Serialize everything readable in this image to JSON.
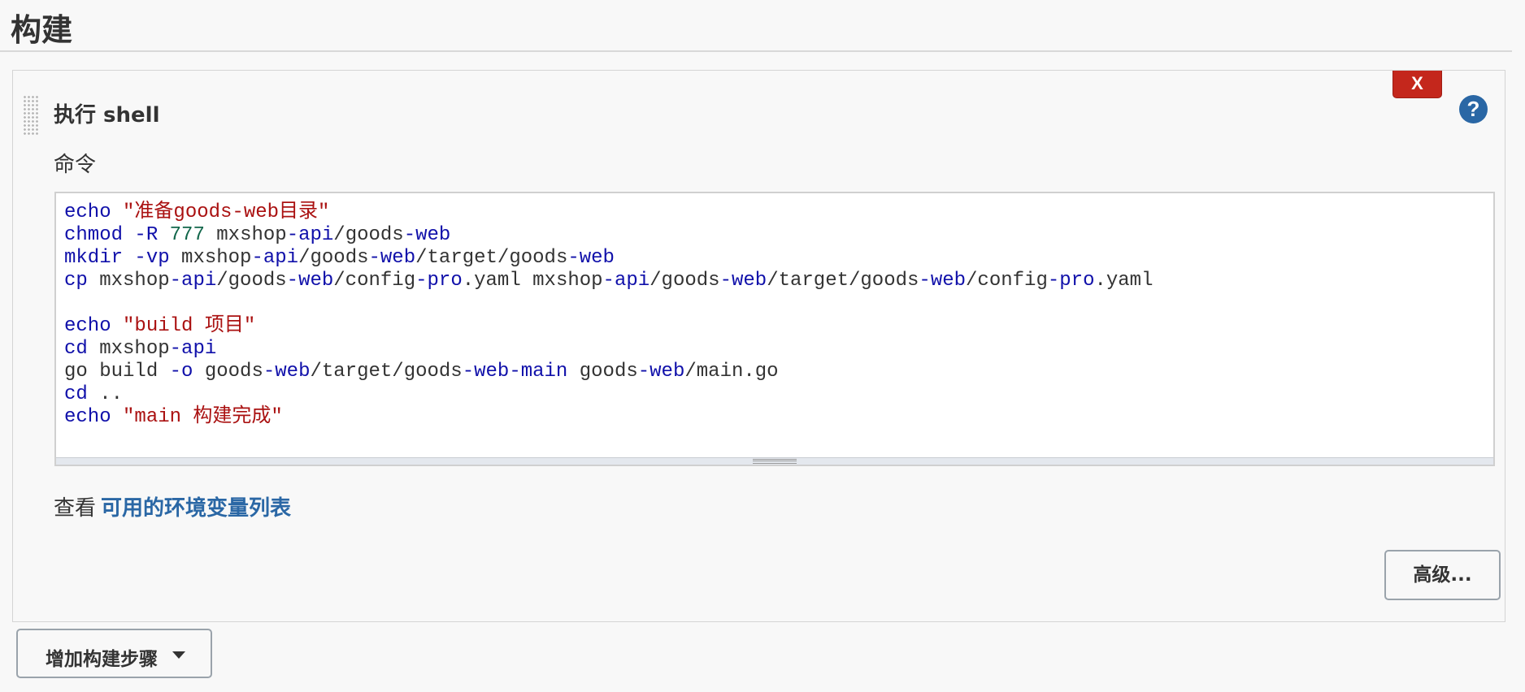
{
  "section": {
    "title": "构建"
  },
  "step": {
    "title": "执行 shell",
    "delete_label": "X",
    "help_label": "?",
    "command_label": "命令",
    "code_lines": [
      [
        [
          "kw",
          "echo"
        ],
        [
          "t",
          " "
        ],
        [
          "str",
          "\"准备goods-web目录\""
        ]
      ],
      [
        [
          "kw",
          "chmod"
        ],
        [
          "t",
          " "
        ],
        [
          "kw",
          "-R"
        ],
        [
          "t",
          " "
        ],
        [
          "num",
          "777"
        ],
        [
          "t",
          " mxshop"
        ],
        [
          "kw",
          "-api"
        ],
        [
          "t",
          "/goods"
        ],
        [
          "kw",
          "-web"
        ]
      ],
      [
        [
          "kw",
          "mkdir"
        ],
        [
          "t",
          " "
        ],
        [
          "kw",
          "-vp"
        ],
        [
          "t",
          " mxshop"
        ],
        [
          "kw",
          "-api"
        ],
        [
          "t",
          "/goods"
        ],
        [
          "kw",
          "-web"
        ],
        [
          "t",
          "/target/goods"
        ],
        [
          "kw",
          "-web"
        ]
      ],
      [
        [
          "kw",
          "cp"
        ],
        [
          "t",
          " mxshop"
        ],
        [
          "kw",
          "-api"
        ],
        [
          "t",
          "/goods"
        ],
        [
          "kw",
          "-web"
        ],
        [
          "t",
          "/config"
        ],
        [
          "kw",
          "-pro"
        ],
        [
          "t",
          ".yaml mxshop"
        ],
        [
          "kw",
          "-api"
        ],
        [
          "t",
          "/goods"
        ],
        [
          "kw",
          "-web"
        ],
        [
          "t",
          "/target/goods"
        ],
        [
          "kw",
          "-web"
        ],
        [
          "t",
          "/config"
        ],
        [
          "kw",
          "-pro"
        ],
        [
          "t",
          ".yaml"
        ]
      ],
      [],
      [
        [
          "kw",
          "echo"
        ],
        [
          "t",
          " "
        ],
        [
          "str",
          "\"build 项目\""
        ]
      ],
      [
        [
          "kw",
          "cd"
        ],
        [
          "t",
          " mxshop"
        ],
        [
          "kw",
          "-api"
        ]
      ],
      [
        [
          "t",
          "go build "
        ],
        [
          "kw",
          "-o"
        ],
        [
          "t",
          " goods"
        ],
        [
          "kw",
          "-web"
        ],
        [
          "t",
          "/target/goods"
        ],
        [
          "kw",
          "-web-main"
        ],
        [
          "t",
          " goods"
        ],
        [
          "kw",
          "-web"
        ],
        [
          "t",
          "/main.go"
        ]
      ],
      [
        [
          "kw",
          "cd"
        ],
        [
          "t",
          " .."
        ]
      ],
      [
        [
          "kw",
          "echo"
        ],
        [
          "t",
          " "
        ],
        [
          "str",
          "\"main 构建完成\""
        ]
      ]
    ],
    "env_prefix": "查看",
    "env_link": "可用的环境变量列表",
    "advanced_label": "高级..."
  },
  "add_step": {
    "label": "增加构建步骤"
  }
}
